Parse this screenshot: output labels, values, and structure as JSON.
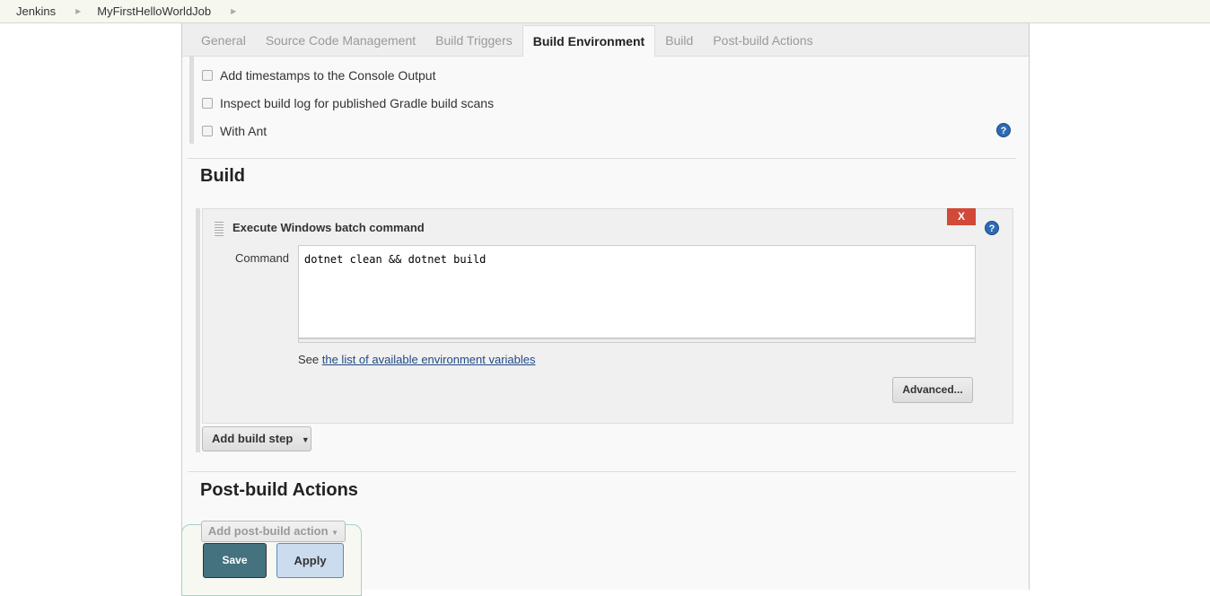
{
  "breadcrumb": [
    "Jenkins",
    "MyFirstHelloWorldJob"
  ],
  "tabs": [
    "General",
    "Source Code Management",
    "Build Triggers",
    "Build Environment",
    "Build",
    "Post-build Actions"
  ],
  "active_tab": "Build Environment",
  "env_options": [
    "Add timestamps to the Console Output",
    "Inspect build log for published Gradle build scans",
    "With Ant"
  ],
  "build": {
    "title": "Build",
    "step_title": "Execute Windows batch command",
    "delete_label": "X",
    "command_label": "Command",
    "command_value": "dotnet clean && dotnet build",
    "see_prefix": "See ",
    "env_link": "the list of available environment variables",
    "advanced": "Advanced...",
    "add_step": "Add build step"
  },
  "post": {
    "title": "Post-build Actions",
    "add_action": "Add post-build action"
  },
  "footer": {
    "save": "Save",
    "apply": "Apply"
  },
  "colors": {
    "save": "#44727f",
    "apply": "#cbdcee",
    "delete": "#d24939",
    "help": "#2d6ab5"
  }
}
